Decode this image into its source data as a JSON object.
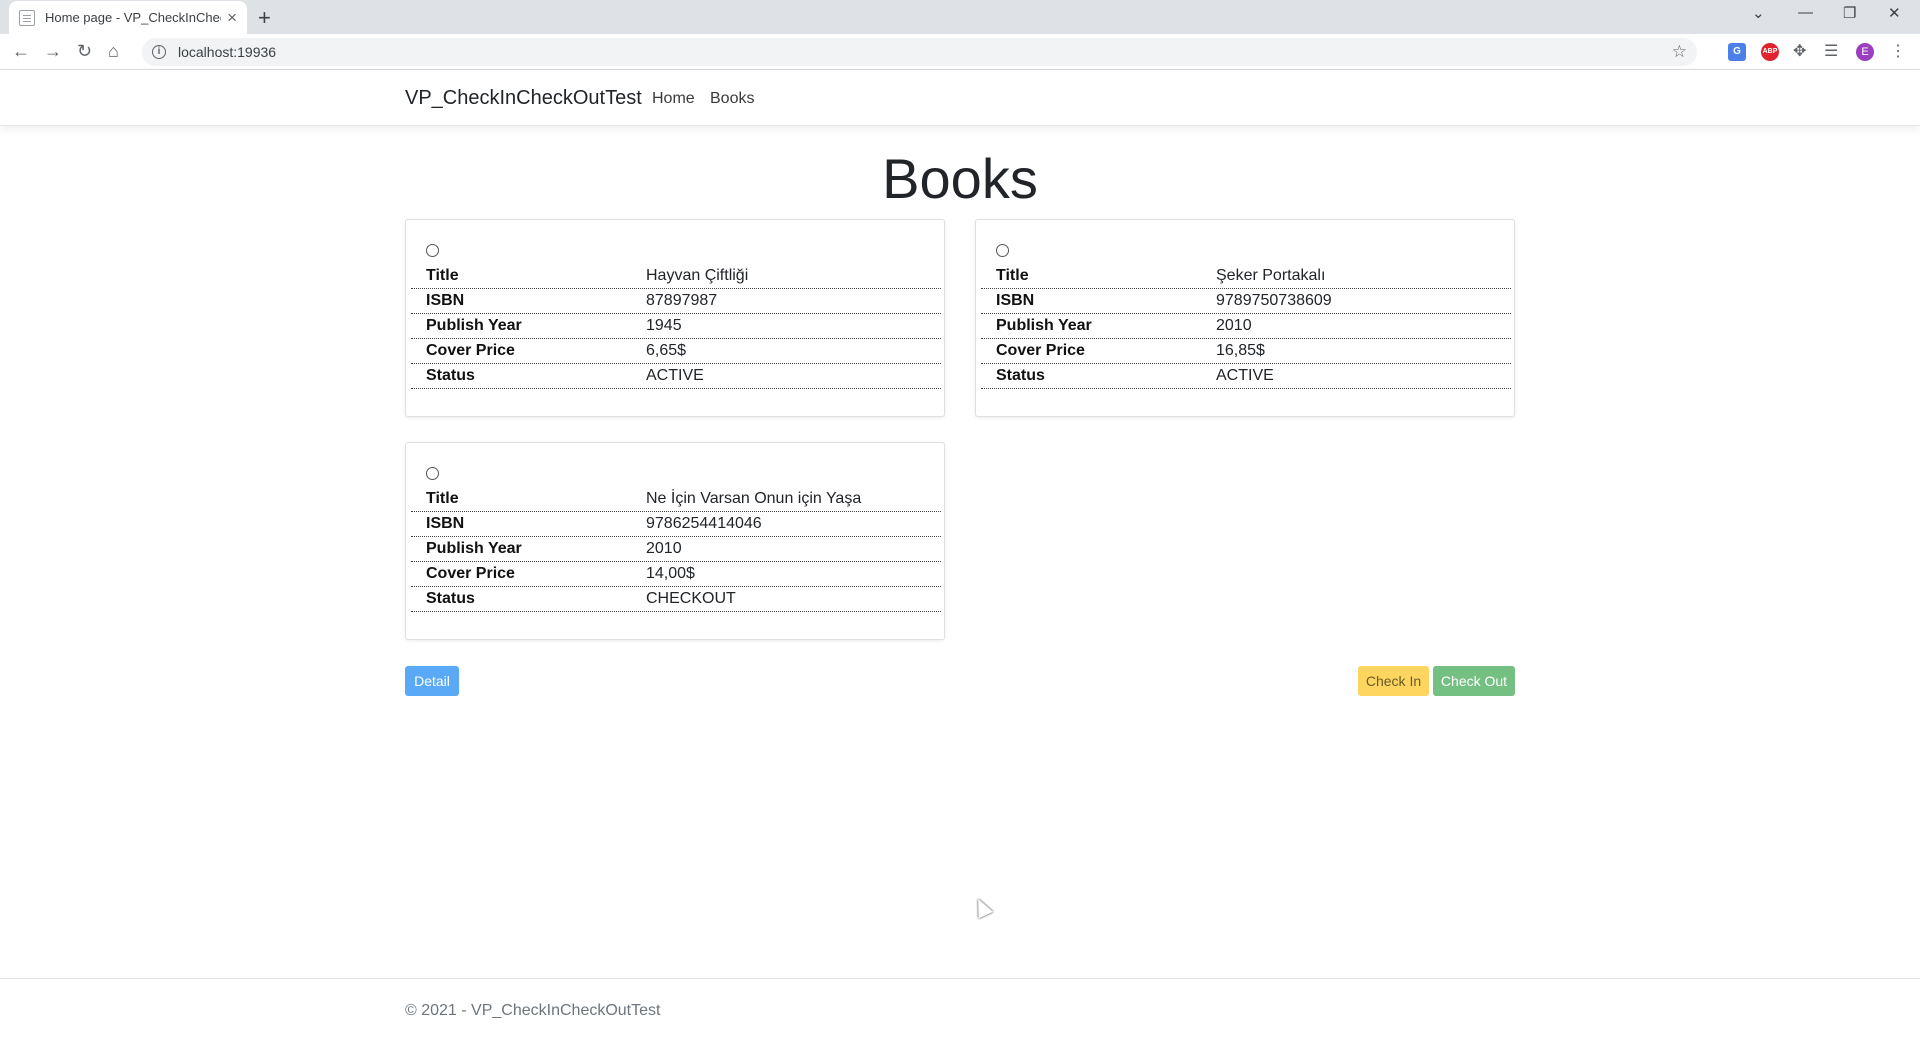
{
  "browser": {
    "tab_title": "Home page - VP_CheckInCheckO",
    "url": "localhost:19936",
    "ext_translate": "G",
    "ext_abp": "ABP",
    "avatar_letter": "E"
  },
  "navbar": {
    "brand": "VP_CheckInCheckOutTest",
    "links": [
      "Home",
      "Books"
    ]
  },
  "main": {
    "title": "Books",
    "field_labels": [
      "Title",
      "ISBN",
      "Publish Year",
      "Cover Price",
      "Status"
    ],
    "books": [
      {
        "title": "Hayvan Çiftliği",
        "isbn": "87897987",
        "publish_year": "1945",
        "cover_price": "6,65$",
        "status": "ACTIVE"
      },
      {
        "title": "Şeker Portakalı",
        "isbn": "9789750738609",
        "publish_year": "2010",
        "cover_price": "16,85$",
        "status": "ACTIVE"
      },
      {
        "title": "Ne İçin Varsan Onun için Yaşa",
        "isbn": "9786254414046",
        "publish_year": "2010",
        "cover_price": "14,00$",
        "status": "CHECKOUT"
      }
    ],
    "buttons": {
      "detail": "Detail",
      "check_in": "Check In",
      "check_out": "Check Out"
    }
  },
  "footer": {
    "text": "© 2021 - VP_CheckInCheckOutTest"
  }
}
